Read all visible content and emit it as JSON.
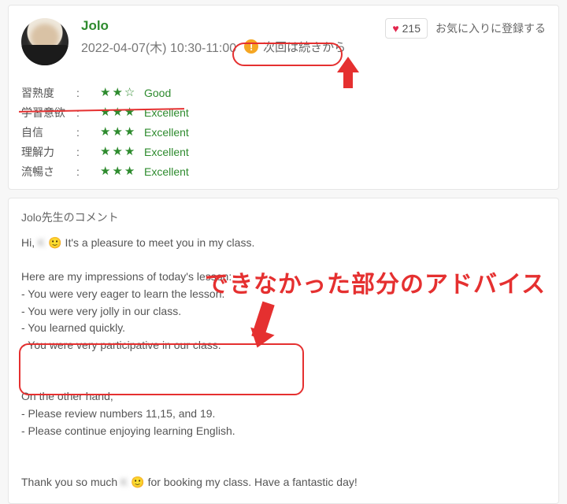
{
  "header": {
    "teacher_name": "Jolo",
    "datetime": "2022-04-07(木) 10:30-11:00",
    "continue_label": "次回は続きから",
    "favorite_count": "215",
    "favorite_label": "お気に入りに登録する"
  },
  "ratings": [
    {
      "label": "習熟度",
      "stars": "★★☆",
      "text": "Good"
    },
    {
      "label": "学習意欲",
      "stars": "★★★",
      "text": "Excellent"
    },
    {
      "label": "自信",
      "stars": "★★★",
      "text": "Excellent"
    },
    {
      "label": "理解力",
      "stars": "★★★",
      "text": "Excellent"
    },
    {
      "label": "流暢さ",
      "stars": "★★★",
      "text": "Excellent"
    }
  ],
  "comment": {
    "title": "Jolo先生のコメント",
    "greeting_pre": "Hi, ",
    "greeting_name_blur": "K   ",
    "greeting_post": " 🙂 It's a pleasure to meet you in my class.",
    "impressions_heading": "Here are my impressions of today's lesson:",
    "impressions": [
      "- You were very eager to learn the lesson.",
      "- You were very jolly in our class.",
      "- You learned quickly.",
      "- You were very participative in our class."
    ],
    "otherhand_heading": "On the other hand,",
    "otherhand": [
      "- Please review numbers 11,15, and 19.",
      "- Please continue enjoying learning English."
    ],
    "thanks_pre": "Thank you so much ",
    "thanks_name_blur": "K   ",
    "thanks_post": " 🙂 for booking my class. Have a fantastic day!"
  },
  "annotations": {
    "big_text": "できなかった部分のアドバイス"
  }
}
